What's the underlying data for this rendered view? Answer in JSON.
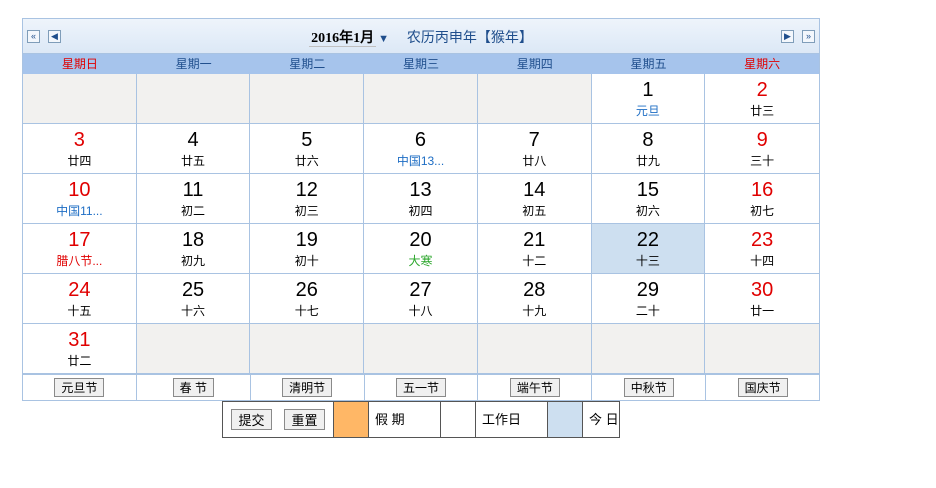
{
  "header": {
    "prev_year_icon": "«",
    "prev_month_icon": "◀",
    "next_month_icon": "▶",
    "next_year_icon": "»",
    "year_month": "2016年1月",
    "dropdown_icon": "▼",
    "lunar_year": "农历丙申年【猴年】"
  },
  "weekdays": [
    "星期日",
    "星期一",
    "星期二",
    "星期三",
    "星期四",
    "星期五",
    "星期六"
  ],
  "weeks": [
    [
      null,
      null,
      null,
      null,
      null,
      {
        "d": "1",
        "s": "元旦",
        "c": "blue"
      },
      {
        "d": "2",
        "s": "廿三"
      }
    ],
    [
      {
        "d": "3",
        "s": "廿四"
      },
      {
        "d": "4",
        "s": "廿五"
      },
      {
        "d": "5",
        "s": "廿六"
      },
      {
        "d": "6",
        "s": "中国13...",
        "c": "blue"
      },
      {
        "d": "7",
        "s": "廿八"
      },
      {
        "d": "8",
        "s": "廿九"
      },
      {
        "d": "9",
        "s": "三十"
      }
    ],
    [
      {
        "d": "10",
        "s": "中国11...",
        "c": "blue"
      },
      {
        "d": "11",
        "s": "初二"
      },
      {
        "d": "12",
        "s": "初三"
      },
      {
        "d": "13",
        "s": "初四"
      },
      {
        "d": "14",
        "s": "初五"
      },
      {
        "d": "15",
        "s": "初六"
      },
      {
        "d": "16",
        "s": "初七"
      }
    ],
    [
      {
        "d": "17",
        "s": "腊八节...",
        "c": "red"
      },
      {
        "d": "18",
        "s": "初九"
      },
      {
        "d": "19",
        "s": "初十"
      },
      {
        "d": "20",
        "s": "大寒",
        "c": "green"
      },
      {
        "d": "21",
        "s": "十二"
      },
      {
        "d": "22",
        "s": "十三",
        "today": true
      },
      {
        "d": "23",
        "s": "十四"
      }
    ],
    [
      {
        "d": "24",
        "s": "十五"
      },
      {
        "d": "25",
        "s": "十六"
      },
      {
        "d": "26",
        "s": "十七"
      },
      {
        "d": "27",
        "s": "十八"
      },
      {
        "d": "28",
        "s": "十九"
      },
      {
        "d": "29",
        "s": "二十"
      },
      {
        "d": "30",
        "s": "廿一"
      }
    ],
    [
      {
        "d": "31",
        "s": "廿二"
      },
      null,
      null,
      null,
      null,
      null,
      null
    ]
  ],
  "festivals": [
    "元旦节",
    "春  节",
    "清明节",
    "五一节",
    "端午节",
    "中秋节",
    "国庆节"
  ],
  "legend": {
    "submit": "提交",
    "reset": "重置",
    "holiday": "假  期",
    "workday": "工作日",
    "today": "今 日"
  },
  "colors": {
    "weekend_red": "#e00000",
    "holiday_swatch": "#ffb766",
    "workday_swatch": "#ffffff",
    "today_swatch": "#cddff0"
  }
}
